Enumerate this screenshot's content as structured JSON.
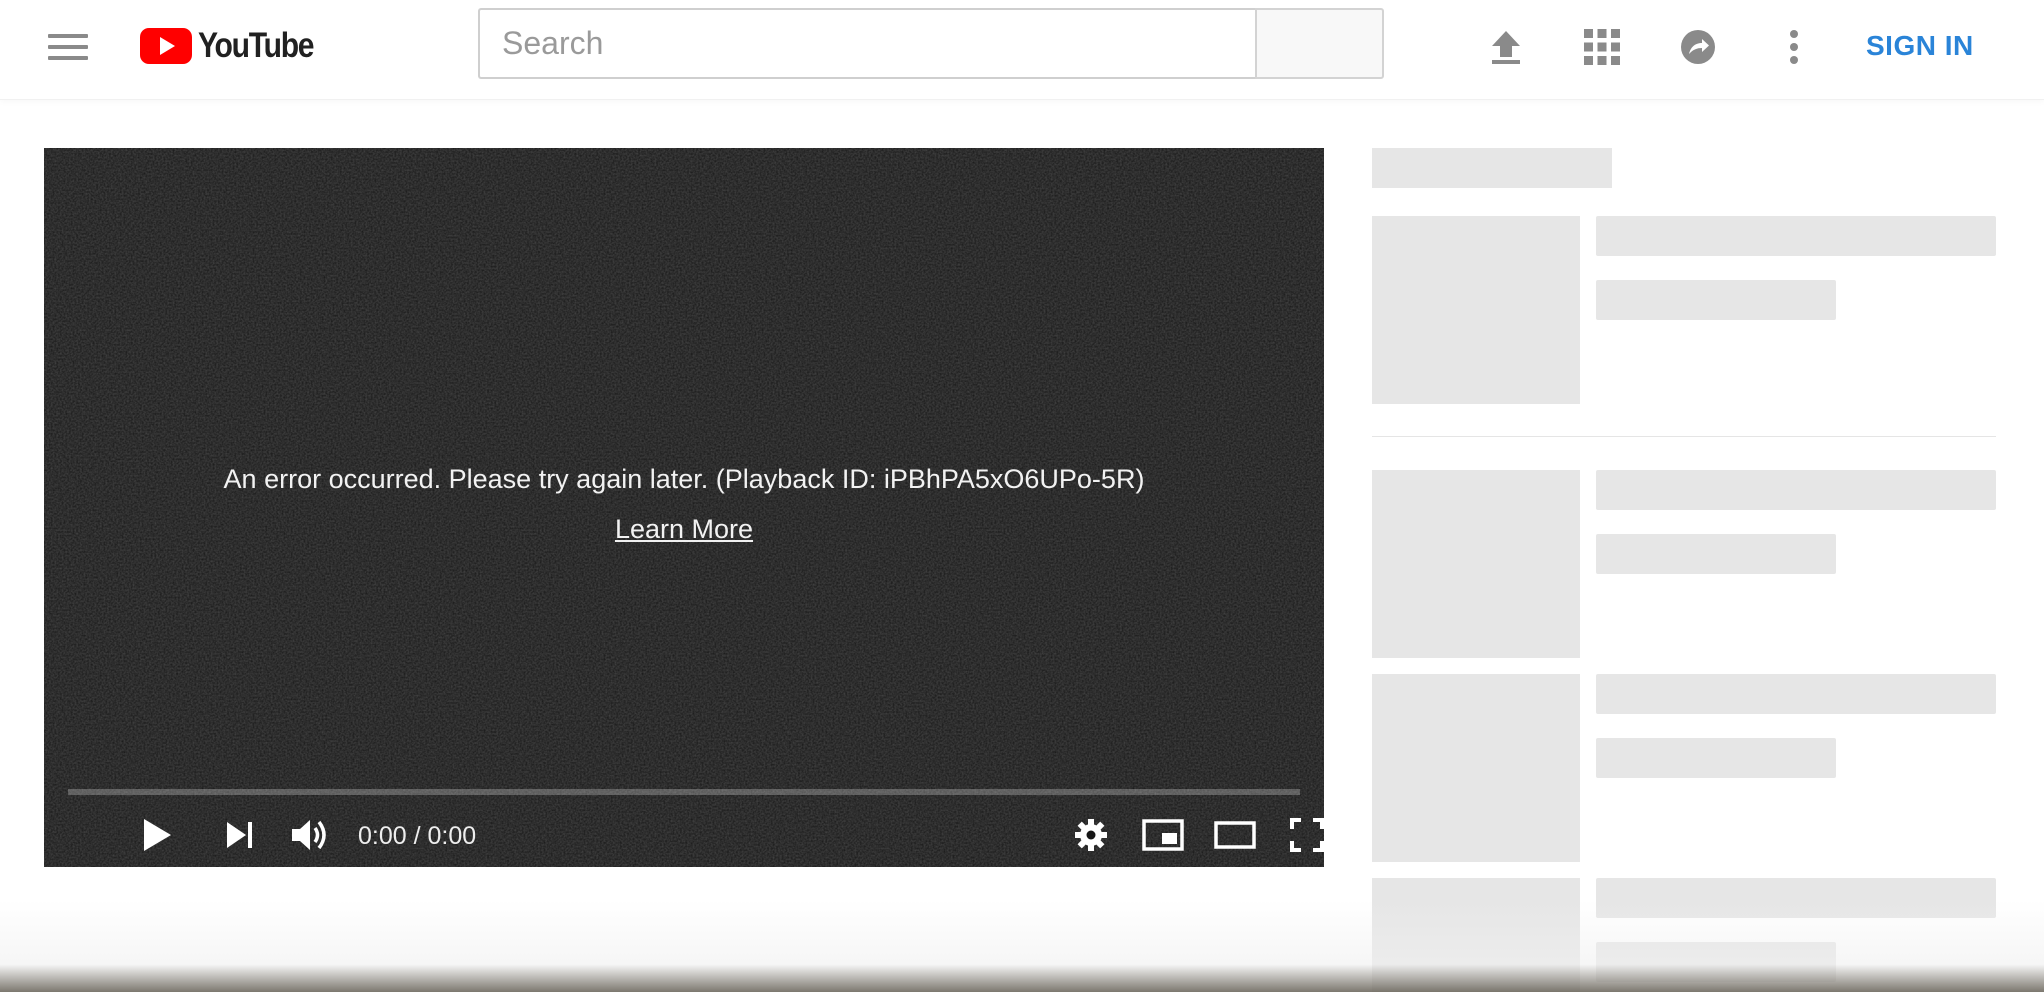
{
  "brand": {
    "wordmark": "YouTube",
    "red": "#ff0000",
    "text_color": "#212121"
  },
  "masthead": {
    "search_placeholder": "Search",
    "sign_in_label": "SIGN IN",
    "icons": [
      "menu-icon",
      "upload-icon",
      "apps-grid-icon",
      "share-icon",
      "more-vert-icon"
    ]
  },
  "player": {
    "error_message": "An error occurred. Please try again later. (Playback ID: iPBhPA5xO6UPo-5R)",
    "learn_more": "Learn More",
    "time_display": "0:00 / 0:00",
    "progress_fraction": 0,
    "controls": [
      "play-icon",
      "next-icon",
      "volume-icon",
      "settings-icon",
      "miniplayer-icon",
      "theater-mode-icon",
      "fullscreen-icon"
    ]
  },
  "sidebar": {
    "loading": true,
    "placeholder_color": "#e6e6e6"
  },
  "colors": {
    "accent": "#2a84d8",
    "player_bg": "#161616",
    "icon_gray": "#8a8a8a"
  }
}
